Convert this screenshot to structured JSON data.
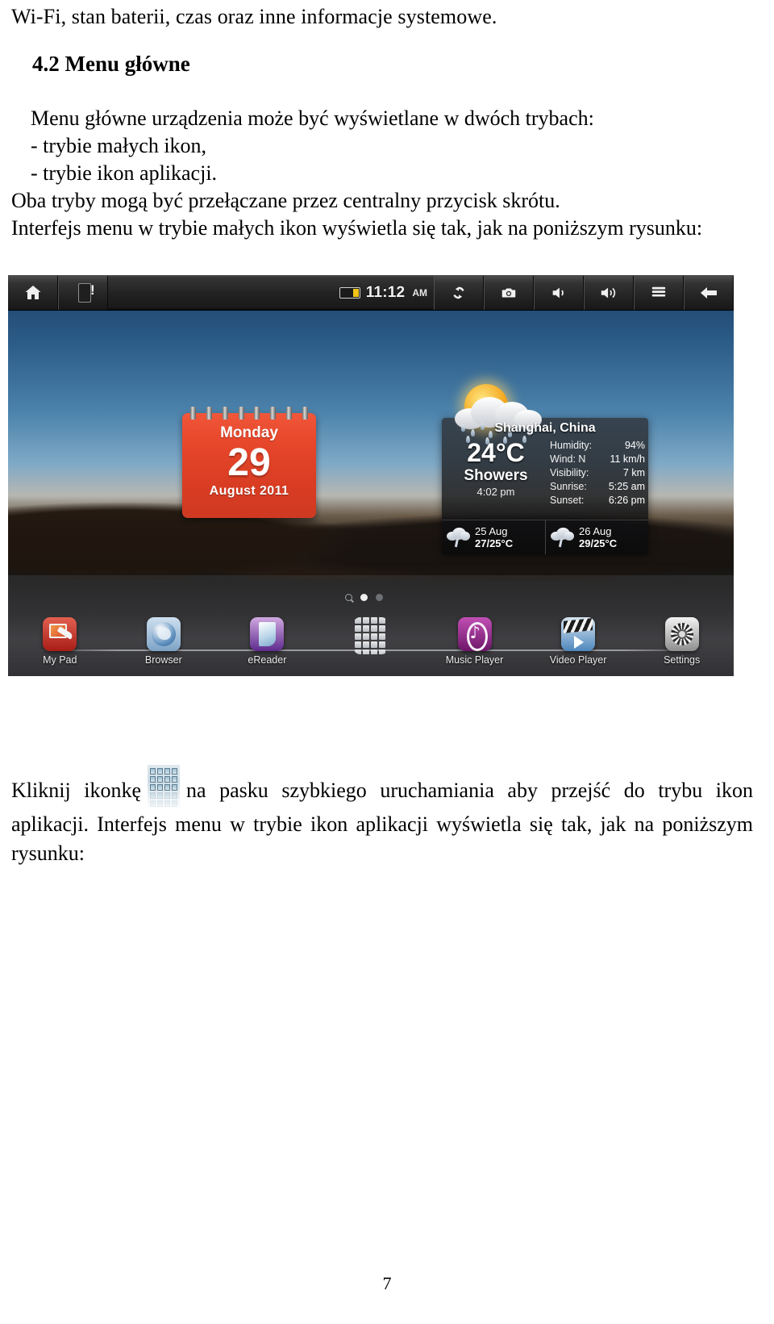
{
  "document": {
    "intro_line": "Wi-Fi, stan baterii, czas oraz inne informacje systemowe.",
    "heading": "4.2 Menu główne",
    "paragraph_lines": [
      "Menu główne urządzenia może być wyświetlane w dwóch trybach:",
      "- trybie małych ikon,",
      "- trybie ikon aplikacji.",
      "Oba tryby mogą być przełączane przez centralny przycisk skrótu.",
      "Interfejs menu w trybie małych ikon wyświetla się tak, jak na poniższym rysunku:"
    ],
    "bottom_paragraph_part1": "Kliknij ikonkę",
    "bottom_paragraph_part2": "na pasku szybkiego uruchamiania aby przejść do trybu ikon aplikacji. Interfejs menu w trybie ikon aplikacji wyświetla się tak, jak na poniższym rysunku:",
    "page_number": "7"
  },
  "tablet": {
    "statusbar": {
      "home_icon": "home-icon",
      "sdcard_icon": "sdcard-warning-icon",
      "battery_icon": "battery-icon",
      "time": "11:12",
      "ampm": "AM",
      "buttons": [
        {
          "icon": "refresh-icon",
          "name": "refresh-button"
        },
        {
          "icon": "camera-icon",
          "name": "screenshot-button"
        },
        {
          "icon": "volume-down-icon",
          "name": "volume-down-button"
        },
        {
          "icon": "volume-up-icon",
          "name": "volume-up-button"
        },
        {
          "icon": "menu-icon",
          "name": "menu-button"
        },
        {
          "icon": "back-arrow-icon",
          "name": "back-button"
        }
      ]
    },
    "calendar_widget": {
      "weekday": "Monday",
      "day": "29",
      "month_year": "August  2011"
    },
    "weather_widget": {
      "location": "Shanghai, China",
      "temperature": "24°C",
      "condition": "Showers",
      "observed_time": "4:02 pm",
      "details": [
        {
          "label": "Humidity:",
          "value": "94%"
        },
        {
          "label": "Wind: N",
          "value": "11 km/h"
        },
        {
          "label": "Visibility:",
          "value": "7 km"
        },
        {
          "label": "Sunrise:",
          "value": "5:25 am"
        },
        {
          "label": "Sunset:",
          "value": "6:26 pm"
        }
      ],
      "forecast": [
        {
          "date": "25 Aug",
          "temps": "27/25°C",
          "icon": "rain-cloud-icon"
        },
        {
          "date": "26 Aug",
          "temps": "29/25°C",
          "icon": "rain-cloud-icon"
        }
      ]
    },
    "page_dots": {
      "search_icon": "search-icon",
      "active_index": 0,
      "count": 2
    },
    "dock": {
      "apps": [
        {
          "label": "My Pad",
          "icon": "mypad-icon"
        },
        {
          "label": "Browser",
          "icon": "browser-globe-icon"
        },
        {
          "label": "eReader",
          "icon": "ereader-icon"
        },
        {
          "label": "",
          "icon": "app-grid-icon"
        },
        {
          "label": "Music Player",
          "icon": "music-note-icon"
        },
        {
          "label": "Video Player",
          "icon": "video-clapboard-icon"
        },
        {
          "label": "Settings",
          "icon": "settings-gear-icon"
        }
      ]
    }
  }
}
